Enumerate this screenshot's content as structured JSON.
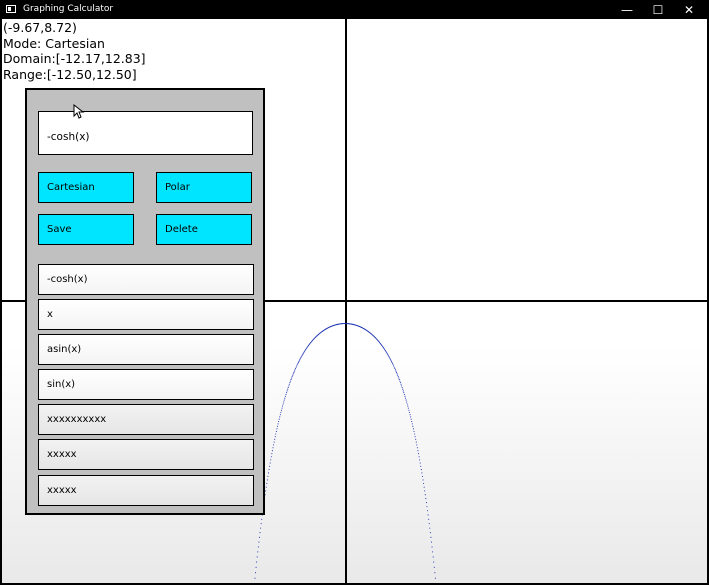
{
  "window": {
    "title": "Graphing Calculator",
    "controls": {
      "minimize": "—",
      "maximize": "☐",
      "close": "✕"
    }
  },
  "readout": {
    "coords": "(-9.67,8.72)",
    "mode": "Mode: Cartesian",
    "domain": "Domain:[-12.17,12.83]",
    "range": "Range:[-12.50,12.50]"
  },
  "panel": {
    "expression_value": "-cosh(x)",
    "buttons": {
      "cartesian": "Cartesian",
      "polar": "Polar",
      "save": "Save",
      "delete": "Delete"
    },
    "saved_functions": [
      "-cosh(x)",
      "x",
      "asin(x)",
      "sin(x)",
      "xxxxxxxxxx",
      "xxxxx",
      "xxxxx"
    ]
  },
  "plot": {
    "function": "-cosh(x)",
    "curve_color": "#1a2fb0",
    "axis_color": "#000000",
    "button_color": "#00e5ff"
  }
}
